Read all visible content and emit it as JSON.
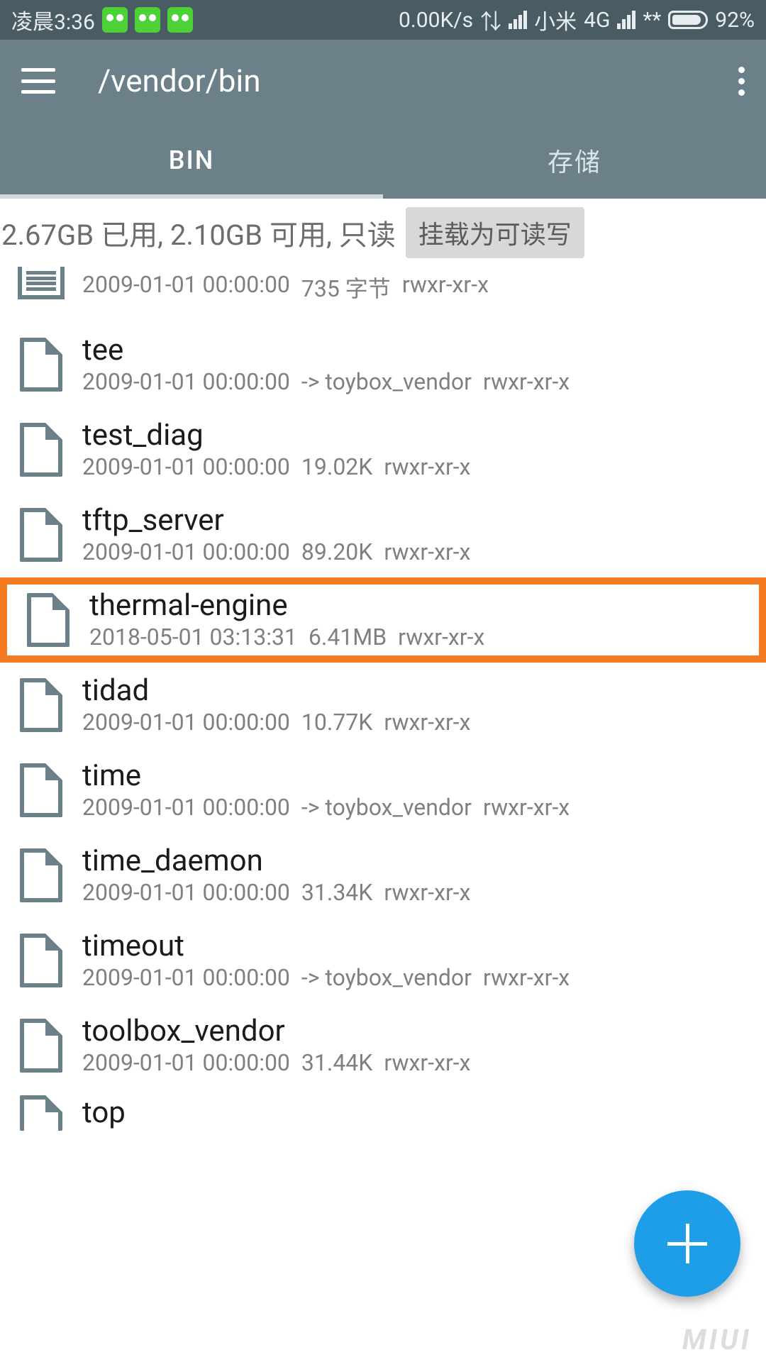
{
  "statusbar": {
    "time": "凌晨3:36",
    "speed": "0.00K/s",
    "carrier": "小米",
    "network": "4G",
    "masked": "**",
    "battery": "92%"
  },
  "appbar": {
    "path": "/vendor/bin"
  },
  "tabs": {
    "active": "BIN",
    "other": "存储"
  },
  "infobar": {
    "text": "2.67GB 已用, 2.10GB 可用, 只读",
    "mount_button": "挂载为可读写"
  },
  "files": [
    {
      "name": ".",
      "icon": "doc",
      "date": "2009-01-01 00:00:00",
      "size": "735 字节",
      "perm": "rwxr-xr-x",
      "highlight": false,
      "partial_top": true
    },
    {
      "name": "tee",
      "icon": "file",
      "date": "2009-01-01 00:00:00",
      "size": "-> toybox_vendor",
      "perm": "rwxr-xr-x",
      "highlight": false
    },
    {
      "name": "test_diag",
      "icon": "file",
      "date": "2009-01-01 00:00:00",
      "size": "19.02K",
      "perm": "rwxr-xr-x",
      "highlight": false
    },
    {
      "name": "tftp_server",
      "icon": "file",
      "date": "2009-01-01 00:00:00",
      "size": "89.20K",
      "perm": "rwxr-xr-x",
      "highlight": false
    },
    {
      "name": "thermal-engine",
      "icon": "file",
      "date": "2018-05-01 03:13:31",
      "size": "6.41MB",
      "perm": "rwxr-xr-x",
      "highlight": true
    },
    {
      "name": "tidad",
      "icon": "file",
      "date": "2009-01-01 00:00:00",
      "size": "10.77K",
      "perm": "rwxr-xr-x",
      "highlight": false
    },
    {
      "name": "time",
      "icon": "file",
      "date": "2009-01-01 00:00:00",
      "size": "-> toybox_vendor",
      "perm": "rwxr-xr-x",
      "highlight": false
    },
    {
      "name": "time_daemon",
      "icon": "file",
      "date": "2009-01-01 00:00:00",
      "size": "31.34K",
      "perm": "rwxr-xr-x",
      "highlight": false
    },
    {
      "name": "timeout",
      "icon": "file",
      "date": "2009-01-01 00:00:00",
      "size": "-> toybox_vendor",
      "perm": "rwxr-xr-x",
      "highlight": false
    },
    {
      "name": "toolbox_vendor",
      "icon": "file",
      "date": "2009-01-01 00:00:00",
      "size": "31.44K",
      "perm": "rwxr-xr-x",
      "highlight": false
    },
    {
      "name": "top",
      "icon": "file",
      "date": "",
      "size": "",
      "perm": "",
      "highlight": false,
      "partial_bottom": true
    }
  ],
  "watermark": "MIUI"
}
